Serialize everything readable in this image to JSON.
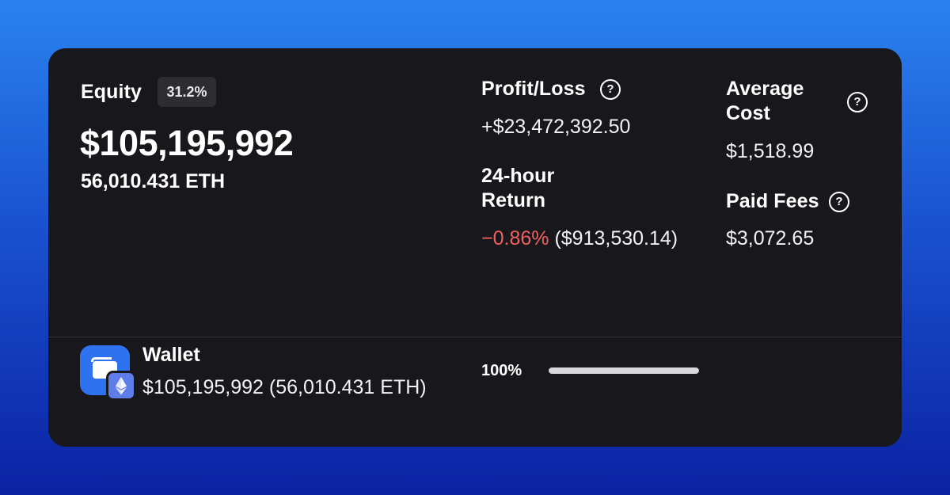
{
  "equity": {
    "label": "Equity",
    "badge": "31.2%",
    "value": "$105,195,992",
    "eth": "56,010.431 ETH"
  },
  "stats": {
    "profit_loss": {
      "title": "Profit/Loss",
      "value": "+$23,472,392.50"
    },
    "return_24h": {
      "title_line1": "24-hour",
      "title_line2": "Return",
      "pct": "−0.86%",
      "amount": "($913,530.14)"
    },
    "average_cost": {
      "title_line1": "Average",
      "title_line2": "Cost",
      "value": "$1,518.99"
    },
    "paid_fees": {
      "title": "Paid Fees",
      "value": "$3,072.65"
    },
    "help_glyph": "?"
  },
  "wallet": {
    "name": "Wallet",
    "balance": "$105,195,992 (56,010.431 ETH)",
    "allocation_label": "100%",
    "allocation_fraction": 1.0,
    "icon": "wallet-icon",
    "badge_icon": "ethereum-icon"
  },
  "colors": {
    "negative": "#f0605e",
    "accent_blue": "#2f72f0",
    "card_bg": "#18181c"
  }
}
